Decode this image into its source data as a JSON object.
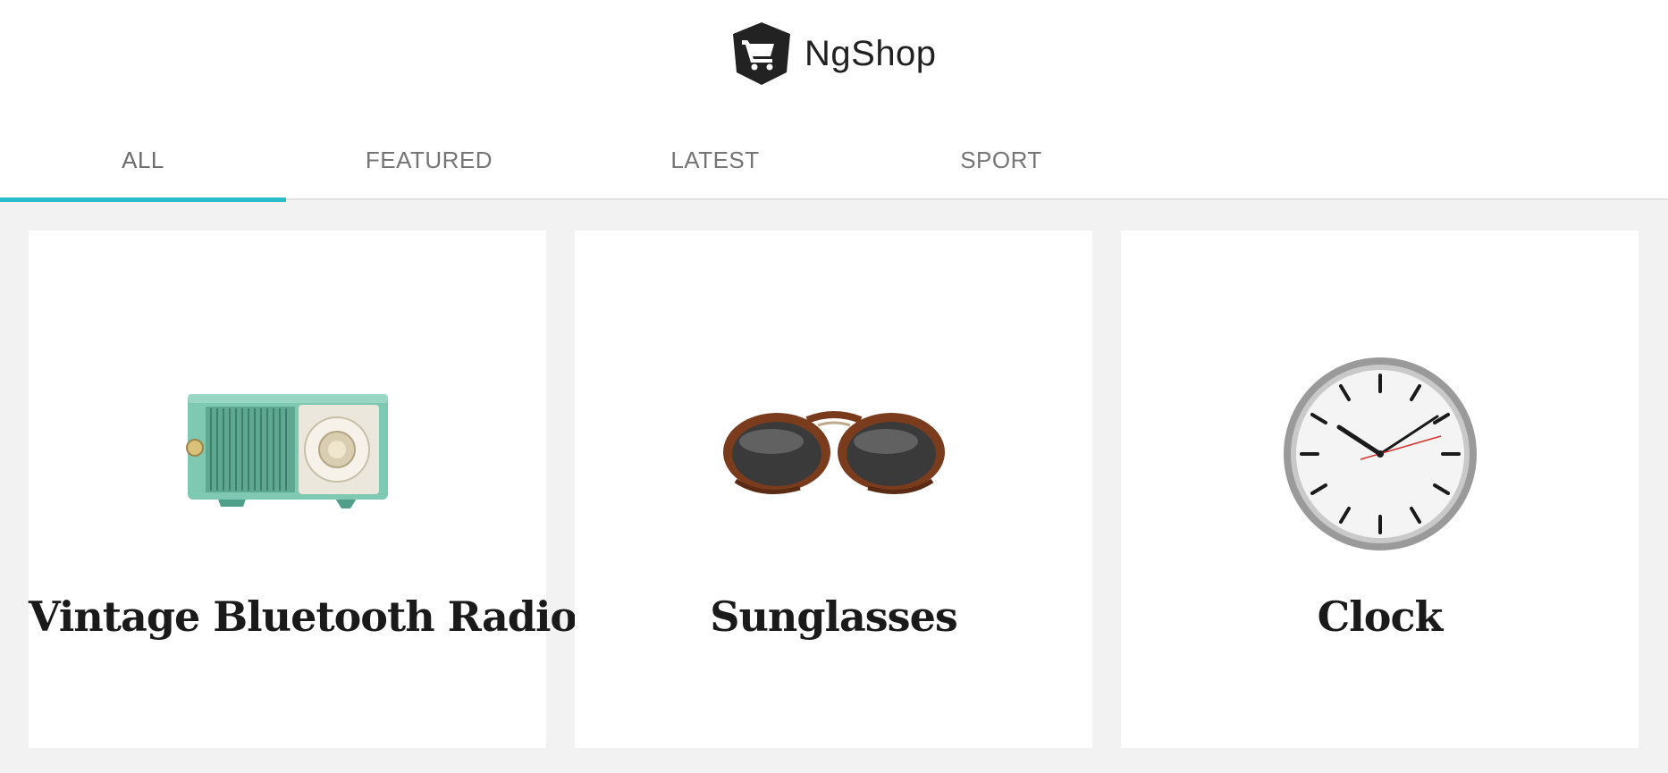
{
  "brand": {
    "name": "NgShop",
    "logo_icon": "shopping-cart-icon"
  },
  "tabs": [
    {
      "label": "ALL",
      "active": true
    },
    {
      "label": "FEATURED",
      "active": false
    },
    {
      "label": "LATEST",
      "active": false
    },
    {
      "label": "SPORT",
      "active": false
    }
  ],
  "products": [
    {
      "title": "Vintage Bluetooth Radio",
      "image": "vintage-radio"
    },
    {
      "title": "Sunglasses",
      "image": "sunglasses"
    },
    {
      "title": "Clock",
      "image": "wall-clock"
    }
  ],
  "colors": {
    "accent": "#26bdc9",
    "background": "#f2f2f2",
    "card": "#ffffff",
    "text": "#212121",
    "tab_text": "#757575"
  }
}
